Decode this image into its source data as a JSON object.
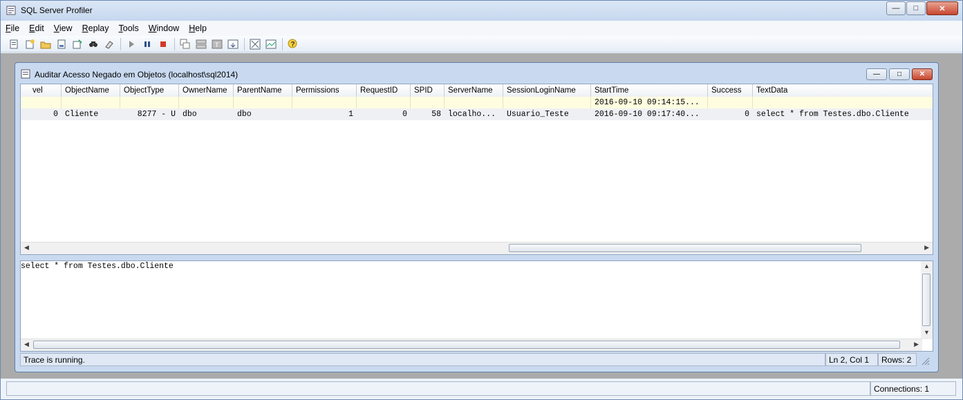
{
  "app": {
    "title": "SQL Server Profiler",
    "menu": [
      {
        "label": "File",
        "key": "F",
        "rest": "ile"
      },
      {
        "label": "Edit",
        "key": "E",
        "rest": "dit"
      },
      {
        "label": "View",
        "key": "V",
        "rest": "iew"
      },
      {
        "label": "Replay",
        "key": "R",
        "rest": "eplay"
      },
      {
        "label": "Tools",
        "key": "T",
        "rest": "ools"
      },
      {
        "label": "Window",
        "key": "W",
        "rest": "indow"
      },
      {
        "label": "Help",
        "key": "H",
        "rest": "elp"
      }
    ],
    "toolbar_icons": [
      "new-trace-icon",
      "new-template-icon",
      "open-icon",
      "save-icon",
      "properties-icon",
      "find-icon",
      "clear-icon",
      "run-icon",
      "pause-icon",
      "stop-icon",
      "cascade-icon",
      "tile-icon",
      "auto-scroll-icon",
      "scroll-icon",
      "activity-monitor-icon",
      "perfmon-icon",
      "help-icon"
    ]
  },
  "trace_window": {
    "title": "Auditar Acesso Negado em Objetos (localhost\\sql2014)",
    "columns": [
      "vel",
      "ObjectName",
      "ObjectType",
      "OwnerName",
      "ParentName",
      "Permissions",
      "RequestID",
      "SPID",
      "ServerName",
      "SessionLoginName",
      "StartTime",
      "Success",
      "TextData"
    ],
    "rows": [
      {
        "vel": "",
        "ObjectName": "",
        "ObjectType": "",
        "OwnerName": "",
        "ParentName": "",
        "Permissions": "",
        "RequestID": "",
        "SPID": "",
        "ServerName": "",
        "SessionLoginName": "",
        "StartTime": "2016-09-10 09:14:15...",
        "Success": "",
        "TextData": ""
      },
      {
        "vel": "0",
        "ObjectName": "Cliente",
        "ObjectType": "8277 - U",
        "OwnerName": "dbo",
        "ParentName": "dbo",
        "Permissions": "1",
        "RequestID": "0",
        "SPID": "58",
        "ServerName": "localho...",
        "SessionLoginName": "Usuario_Teste",
        "StartTime": "2016-09-10 09:17:40...",
        "Success": "0",
        "TextData": "select * from Testes.dbo.Cliente"
      }
    ],
    "text_panel": "select * from Testes.dbo.Cliente",
    "status": {
      "message": "Trace is running.",
      "position": "Ln 2, Col 1",
      "rows": "Rows: 2"
    }
  },
  "app_status": {
    "connections": "Connections: 1"
  }
}
